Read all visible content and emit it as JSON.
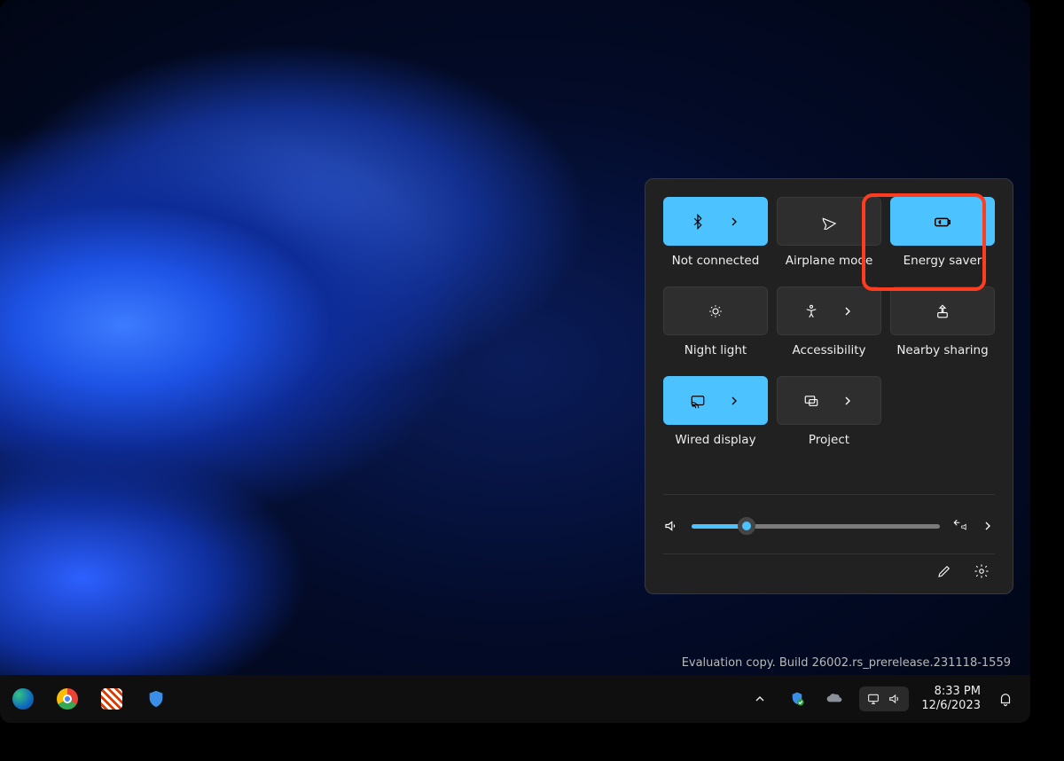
{
  "quick_settings": {
    "tiles": [
      {
        "label": "Not connected",
        "active": true,
        "icon": "bluetooth",
        "has_chevron": true
      },
      {
        "label": "Airplane mode",
        "active": false,
        "icon": "airplane",
        "has_chevron": false
      },
      {
        "label": "Energy saver",
        "active": true,
        "icon": "energy-saver",
        "has_chevron": false
      },
      {
        "label": "Night light",
        "active": false,
        "icon": "night-light",
        "has_chevron": false
      },
      {
        "label": "Accessibility",
        "active": false,
        "icon": "accessibility",
        "has_chevron": true
      },
      {
        "label": "Nearby sharing",
        "active": false,
        "icon": "nearby-share",
        "has_chevron": false
      },
      {
        "label": "Wired display",
        "active": true,
        "icon": "cast",
        "has_chevron": true
      },
      {
        "label": "Project",
        "active": false,
        "icon": "project",
        "has_chevron": true
      }
    ],
    "volume_percent": 22
  },
  "watermark": "Evaluation copy. Build 26002.rs_prerelease.231118-1559",
  "taskbar": {
    "time": "8:33 PM",
    "date": "12/6/2023"
  }
}
